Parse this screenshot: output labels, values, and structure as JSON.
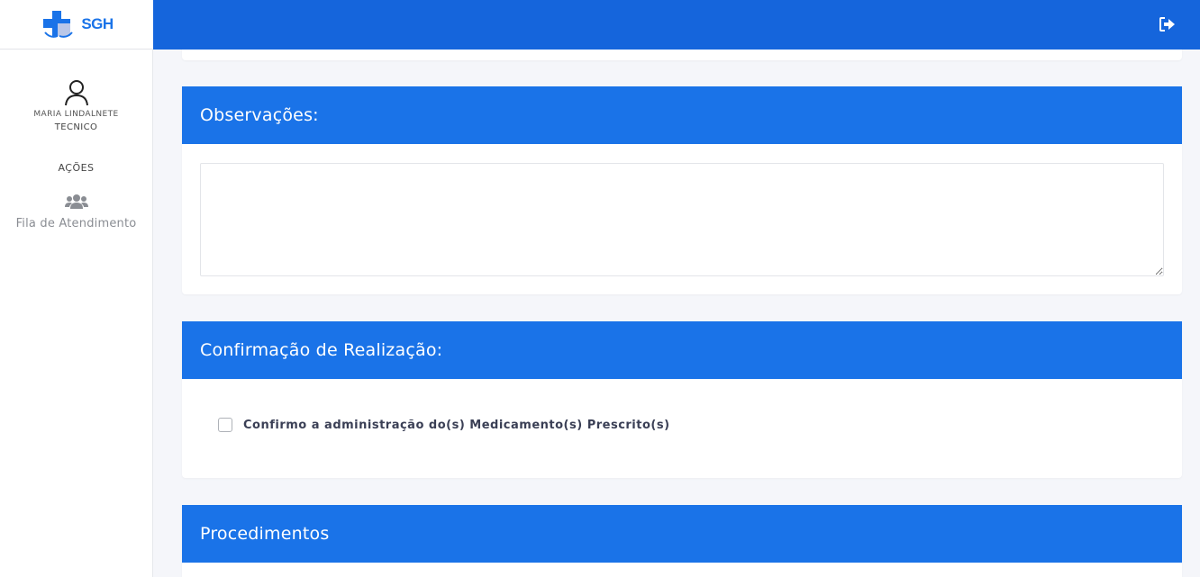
{
  "brand": {
    "name": "SGH"
  },
  "header": {
    "logout_icon": "sign-out-icon"
  },
  "sidebar": {
    "user_name": "MARIA LINDALNETE",
    "user_role": "TECNICO",
    "section_title": "AÇÕES",
    "items": [
      {
        "label": "Fila de Atendimento",
        "icon": "users-icon"
      }
    ]
  },
  "observacoes": {
    "title": "Observações:",
    "value": ""
  },
  "confirmacao": {
    "title": "Confirmação de Realização:",
    "checkbox_label": "Confirmo a administração do(s) Medicamento(s) Prescrito(s)",
    "checked": false
  },
  "procedimentos": {
    "title": "Procedimentos"
  },
  "colors": {
    "topbar": "#1565dc",
    "card_header": "#1a73e8",
    "background": "#f5f6fa"
  }
}
